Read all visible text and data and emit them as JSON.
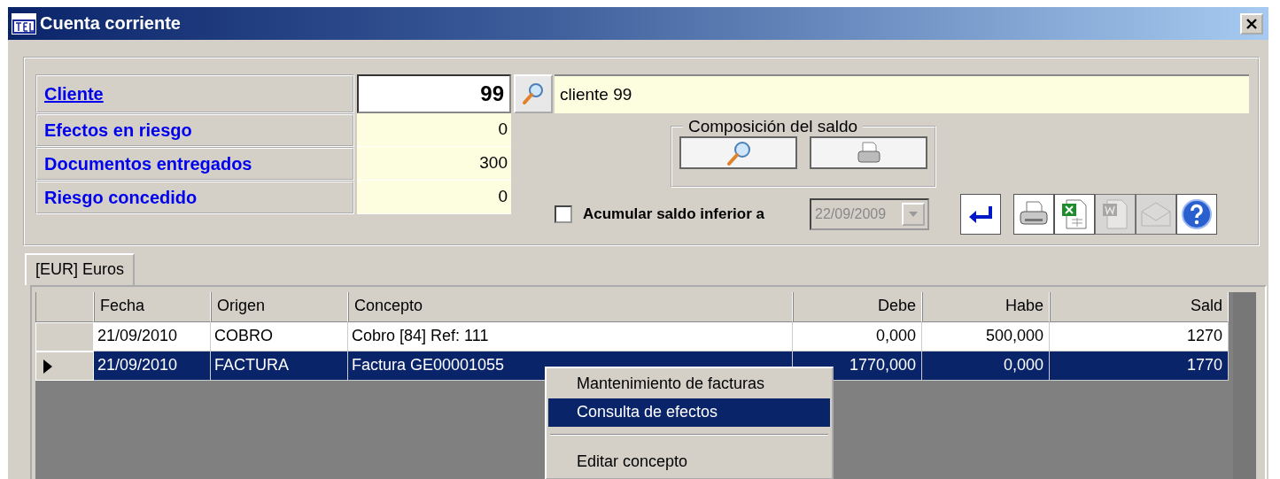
{
  "window": {
    "title": "Cuenta corriente"
  },
  "client": {
    "label": "Cliente",
    "code": "99",
    "name": "cliente 99"
  },
  "summary": [
    {
      "label": "Efectos en riesgo",
      "value": "0"
    },
    {
      "label": "Documentos entregados",
      "value": "300"
    },
    {
      "label": "Riesgo concedido",
      "value": "0"
    }
  ],
  "balance_group": {
    "title": "Composición del saldo"
  },
  "accumulate": {
    "label": "Acumular saldo inferior a",
    "checked": false,
    "date": "22/09/2009",
    "disabled": true
  },
  "toolbar": [
    {
      "kind": "return",
      "disabled": false
    },
    {
      "kind": "print",
      "disabled": false
    },
    {
      "kind": "excel",
      "disabled": false
    },
    {
      "kind": "word",
      "disabled": true
    },
    {
      "kind": "mail",
      "disabled": true
    },
    {
      "kind": "help",
      "disabled": false
    }
  ],
  "tabs": [
    {
      "label": "[EUR] Euros",
      "selected": true
    }
  ],
  "table": {
    "columns": [
      {
        "label": "Fecha",
        "kind": "text"
      },
      {
        "label": "Origen",
        "kind": "text"
      },
      {
        "label": "Concepto",
        "kind": "text"
      },
      {
        "label": "Debe",
        "kind": "number"
      },
      {
        "label": "Habe",
        "kind": "number"
      },
      {
        "label": "Sald",
        "kind": "number"
      }
    ],
    "rows": [
      {
        "selected": false,
        "cells": [
          "21/09/2010",
          "COBRO",
          "Cobro [84]  Ref: 111",
          "0,000",
          "500,000",
          "1270"
        ]
      },
      {
        "selected": true,
        "cells": [
          "21/09/2010",
          "FACTURA",
          "Factura GE00001055",
          "1770,000",
          "0,000",
          "1770"
        ]
      }
    ]
  },
  "context_menu": [
    {
      "kind": "item",
      "label": "Mantenimiento de facturas",
      "selected": false
    },
    {
      "kind": "item",
      "label": "Consulta de efectos",
      "selected": true
    },
    {
      "kind": "separator"
    },
    {
      "kind": "item",
      "label": "Editar concepto",
      "selected": false
    }
  ]
}
